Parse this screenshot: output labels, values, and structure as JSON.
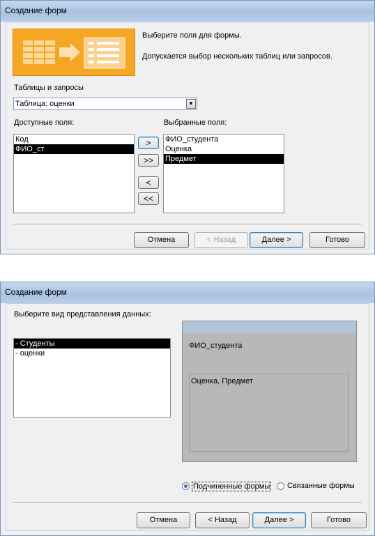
{
  "dialog1": {
    "title": "Создание форм",
    "intro_line1": "Выберите поля для формы.",
    "intro_line2": "Допускается выбор нескольких таблиц или запросов.",
    "tables_label": "Таблицы и запросы",
    "table_value": "Таблица: оценки",
    "available_label": "Доступные поля:",
    "selected_label": "Выбранные поля:",
    "available_fields": [
      "Код",
      "ФИО_ст"
    ],
    "available_selected_index": 1,
    "selected_fields": [
      "ФИО_студента",
      "Оценка",
      "Предмет"
    ],
    "selected_selected_index": 2,
    "move_buttons": [
      ">",
      ">>",
      "<",
      "<<"
    ],
    "buttons": {
      "cancel": "Отмена",
      "back": "< Назад",
      "next": "Далее >",
      "finish": "Готово"
    }
  },
  "dialog2": {
    "title": "Создание форм",
    "prompt": "Выберите вид представления данных:",
    "views": [
      "- Студенты",
      "- оценки"
    ],
    "views_selected_index": 0,
    "preview_main_field": "ФИО_студента",
    "preview_sub_fields": "Оценка, Предмет",
    "option_subforms": "Подчиненные формы",
    "option_linked": "Связанные формы",
    "selected_option": "subforms",
    "buttons": {
      "cancel": "Отмена",
      "back": "< Назад",
      "next": "Далее >",
      "finish": "Готово"
    }
  },
  "colors": {
    "wizard_image_bg": "#f5a623",
    "preview_bg": "#b8b8b8",
    "preview_header": "#b2c6da",
    "selection": "#000000"
  }
}
